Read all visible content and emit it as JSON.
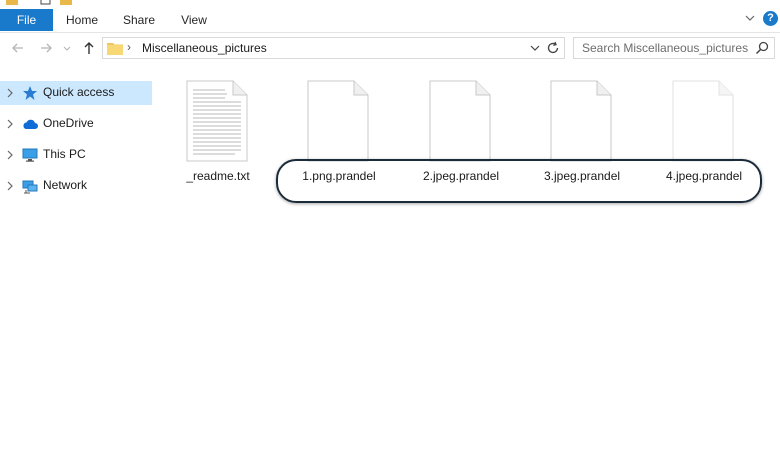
{
  "ribbon": {
    "tabs": [
      {
        "label": "File"
      },
      {
        "label": "Home"
      },
      {
        "label": "Share"
      },
      {
        "label": "View"
      }
    ],
    "help_label": "?"
  },
  "address": {
    "path": "Miscellaneous_pictures",
    "separator": "›"
  },
  "search": {
    "placeholder": "Search Miscellaneous_pictures"
  },
  "sidebar": {
    "items": [
      {
        "label": "Quick access",
        "icon": "star-icon",
        "selected": true
      },
      {
        "label": "OneDrive",
        "icon": "cloud-icon"
      },
      {
        "label": "This PC",
        "icon": "monitor-icon"
      },
      {
        "label": "Network",
        "icon": "network-icon"
      }
    ]
  },
  "files": [
    {
      "name": "_readme.txt",
      "icon": "text-document-icon"
    },
    {
      "name": "1.png.prandel",
      "icon": "blank-document-icon"
    },
    {
      "name": "2.jpeg.prandel",
      "icon": "blank-document-icon"
    },
    {
      "name": "3.jpeg.prandel",
      "icon": "blank-document-icon"
    },
    {
      "name": "4.jpeg.prandel",
      "icon": "blank-document-icon"
    }
  ],
  "colors": {
    "accent": "#1979ca",
    "selection": "#cce8ff",
    "highlight_border": "#1c2b3a"
  }
}
